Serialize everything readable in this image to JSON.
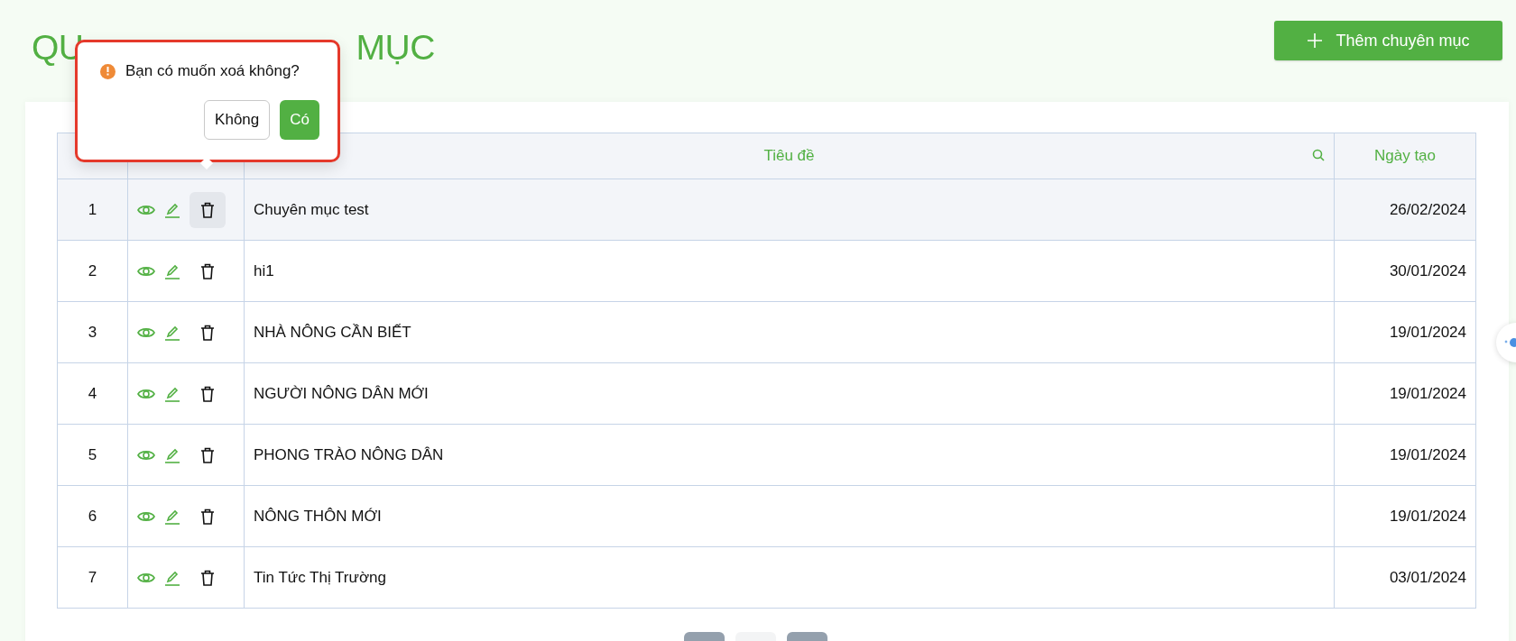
{
  "page_title_parts": [
    "QU",
    "MỤC"
  ],
  "add_button": {
    "label": "Thêm chuyên mục"
  },
  "confirm_popover": {
    "message": "Bạn có muốn xoá không?",
    "buttons": [
      {
        "label": "Không",
        "kind": "secondary"
      },
      {
        "label": "Có",
        "kind": "primary"
      }
    ]
  },
  "table": {
    "columns": [
      {
        "label": "Tiêu đề",
        "searchable": true
      },
      {
        "label": "Ngày tạo",
        "searchable": false
      }
    ],
    "rows": [
      {
        "index": "1",
        "title": "Chuyên mục test",
        "date": "26/02/2024",
        "selected": true
      },
      {
        "index": "2",
        "title": "hi1",
        "date": "30/01/2024",
        "selected": false
      },
      {
        "index": "3",
        "title": "NHÀ NÔNG CẦN BIẾT",
        "date": "19/01/2024",
        "selected": false
      },
      {
        "index": "4",
        "title": "NGƯỜI NÔNG DÂN MỚI",
        "date": "19/01/2024",
        "selected": false
      },
      {
        "index": "5",
        "title": "PHONG TRÀO NÔNG DÂN",
        "date": "19/01/2024",
        "selected": false
      },
      {
        "index": "6",
        "title": "NÔNG THÔN MỚI",
        "date": "19/01/2024",
        "selected": false
      },
      {
        "index": "7",
        "title": "Tin Tức Thị Trường",
        "date": "03/01/2024",
        "selected": false
      }
    ]
  }
}
